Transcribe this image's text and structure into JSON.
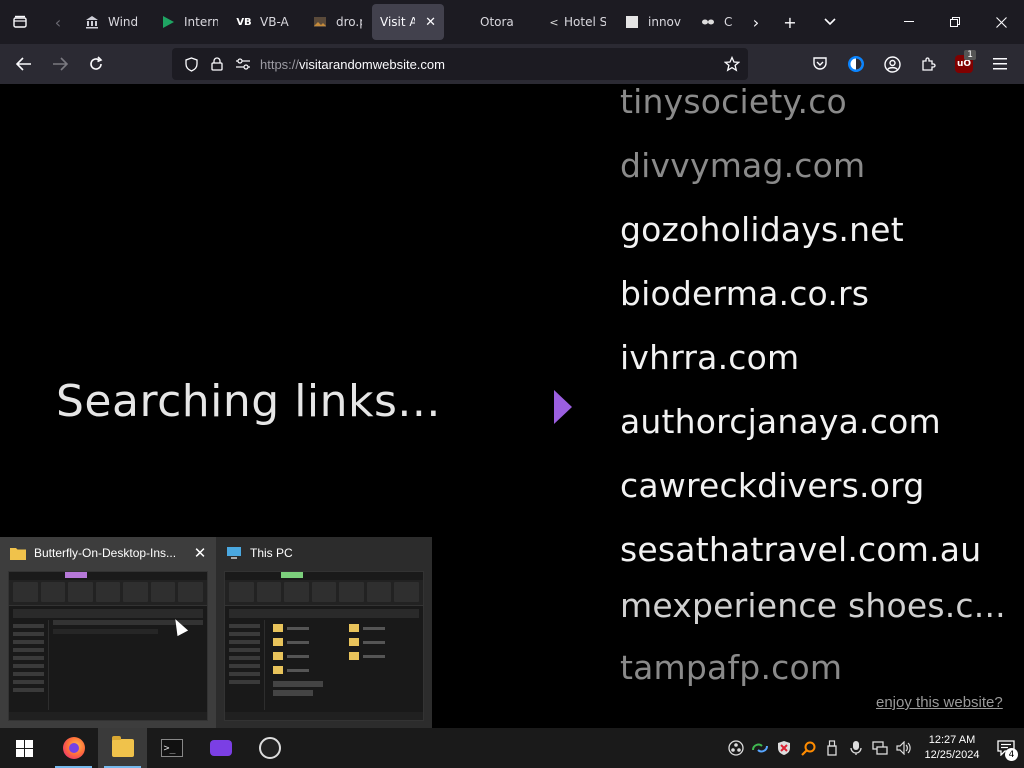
{
  "browser": {
    "tabs": [
      {
        "title": "Wind",
        "icon": "museum-icon",
        "active": false
      },
      {
        "title": "Intern",
        "icon": "flag-icon",
        "active": false
      },
      {
        "title": "VB-A",
        "icon": "vb-icon",
        "active": false
      },
      {
        "title": "dro.p",
        "icon": "image-icon",
        "active": false
      },
      {
        "title": "Visit A",
        "icon": "none",
        "active": true
      },
      {
        "title": "Otora",
        "icon": "none",
        "active": false
      },
      {
        "title": "Hotel S",
        "icon": "share-icon",
        "active": false
      },
      {
        "title": "innov",
        "icon": "page-icon",
        "active": false
      },
      {
        "title": "Ch",
        "icon": "mask-icon",
        "active": false
      }
    ],
    "url_scheme": "https://",
    "url_host": "visitarandomwebsite.com",
    "ublock_count": "1"
  },
  "page": {
    "searching_text": "Searching links...",
    "domains": [
      {
        "text": "tinysociety.co",
        "style": "fade"
      },
      {
        "text": "divvymag.com",
        "style": "fade"
      },
      {
        "text": "gozoholidays.net",
        "style": "normal"
      },
      {
        "text": "bioderma.co.rs",
        "style": "normal"
      },
      {
        "text": "ivhrra.com",
        "style": "normal"
      },
      {
        "text": "authorcjanaya.com",
        "style": "normal"
      },
      {
        "text": "cawreckdivers.org",
        "style": "normal"
      },
      {
        "text": "sesathatravel.com.au",
        "style": "normal"
      },
      {
        "text": "mexperience shoes.c...",
        "style": "garbled"
      },
      {
        "text": "tampafp.com",
        "style": "fade"
      }
    ],
    "enjoy_link": "enjoy this website?",
    "accent_color": "#9b5fe0"
  },
  "popup": {
    "items": [
      {
        "title": "Butterfly-On-Desktop-Ins...",
        "kind": "folder"
      },
      {
        "title": "This PC",
        "kind": "pc"
      }
    ]
  },
  "taskbar": {
    "time": "12:27 AM",
    "date": "12/25/2024",
    "notification_count": "4"
  }
}
